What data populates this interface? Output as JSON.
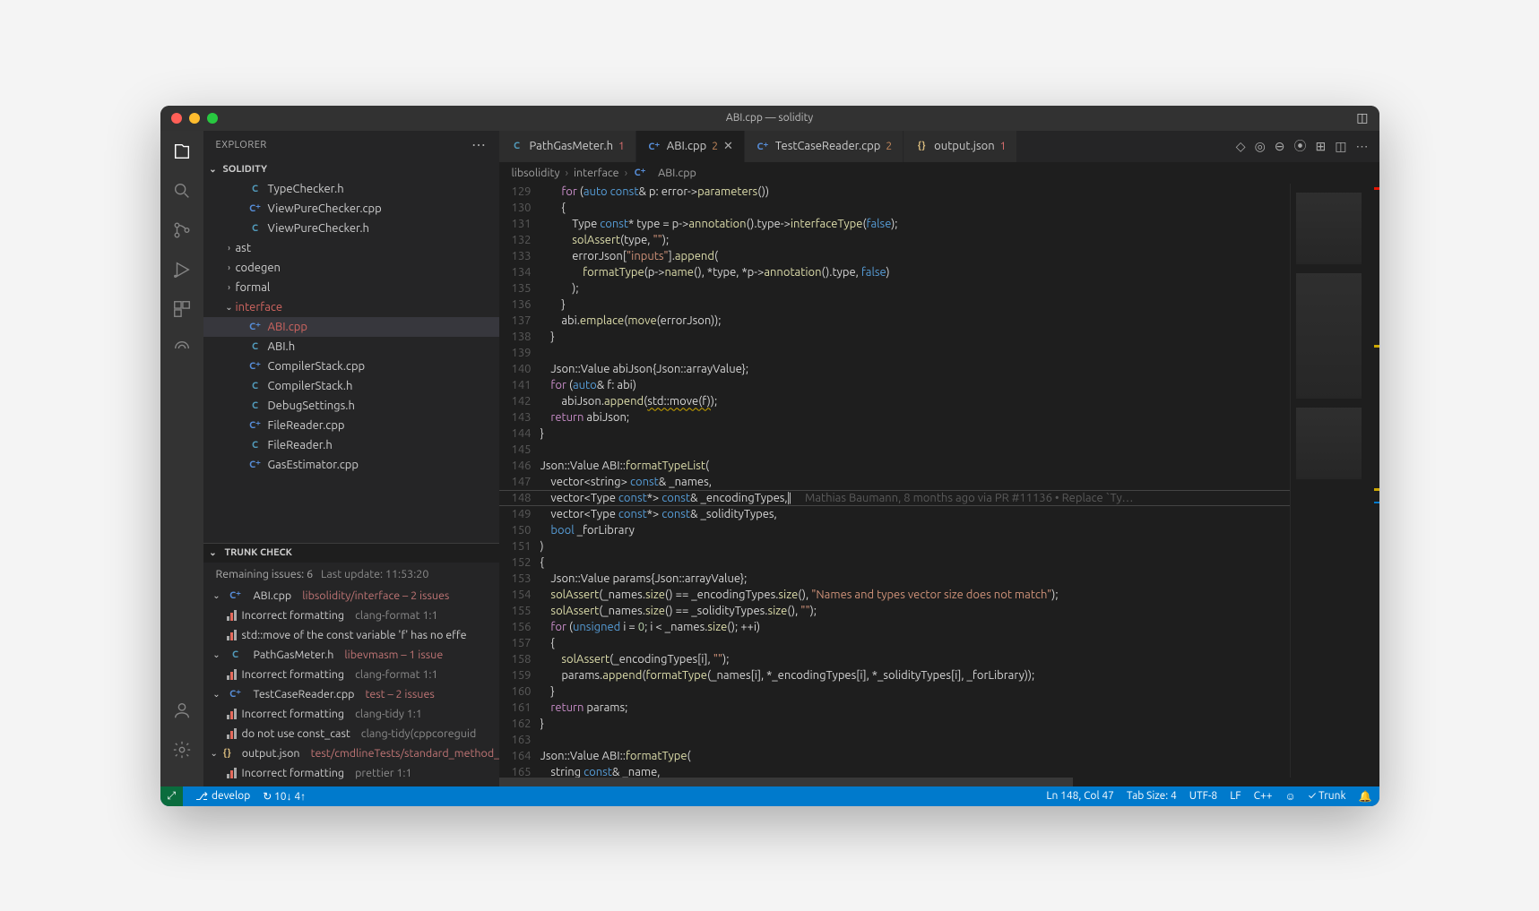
{
  "window": {
    "title": "ABI.cpp — solidity"
  },
  "sidebar": {
    "header": "EXPLORER",
    "root": "SOLIDITY",
    "tree": [
      {
        "icon": "C",
        "label": "TypeChecker.h",
        "cls": "c",
        "indent": 2
      },
      {
        "icon": "C⁺",
        "label": "ViewPureChecker.cpp",
        "cls": "cpp",
        "indent": 2
      },
      {
        "icon": "C",
        "label": "ViewPureChecker.h",
        "cls": "c",
        "indent": 2
      },
      {
        "chev": "›",
        "label": "ast",
        "indent": 1
      },
      {
        "chev": "›",
        "label": "codegen",
        "indent": 1
      },
      {
        "chev": "›",
        "label": "formal",
        "indent": 1
      },
      {
        "chev": "⌄",
        "label": "interface",
        "indent": 1,
        "modified": true
      },
      {
        "icon": "C⁺",
        "label": "ABI.cpp",
        "cls": "cpp",
        "indent": 2,
        "selected": true,
        "modified": true
      },
      {
        "icon": "C",
        "label": "ABI.h",
        "cls": "c",
        "indent": 2
      },
      {
        "icon": "C⁺",
        "label": "CompilerStack.cpp",
        "cls": "cpp",
        "indent": 2
      },
      {
        "icon": "C",
        "label": "CompilerStack.h",
        "cls": "c",
        "indent": 2
      },
      {
        "icon": "C",
        "label": "DebugSettings.h",
        "cls": "c",
        "indent": 2
      },
      {
        "icon": "C⁺",
        "label": "FileReader.cpp",
        "cls": "cpp",
        "indent": 2
      },
      {
        "icon": "C",
        "label": "FileReader.h",
        "cls": "c",
        "indent": 2
      },
      {
        "icon": "C⁺",
        "label": "GasEstimator.cpp",
        "cls": "cpp",
        "indent": 2
      }
    ]
  },
  "trunk": {
    "title": "TRUNK CHECK",
    "summary": "Remaining issues: 6",
    "timestamp": "Last update: 11:53:20",
    "files": [
      {
        "icon": "C⁺",
        "cls": "cpp",
        "name": "ABI.cpp",
        "path": "libsolidity/interface – 2 issues",
        "issues": [
          {
            "msg": "Incorrect formatting",
            "tool": "clang-format 1:1"
          },
          {
            "msg": "std::move of the const variable 'f' has no effe",
            "tool": ""
          }
        ]
      },
      {
        "icon": "C",
        "cls": "c",
        "name": "PathGasMeter.h",
        "path": "libevmasm – 1 issue",
        "issues": [
          {
            "msg": "Incorrect formatting",
            "tool": "clang-format 1:1"
          }
        ]
      },
      {
        "icon": "C⁺",
        "cls": "cpp",
        "name": "TestCaseReader.cpp",
        "path": "test – 2 issues",
        "issues": [
          {
            "msg": "Incorrect formatting",
            "tool": "clang-tidy 1:1"
          },
          {
            "msg": "do not use const_cast",
            "tool": "clang-tidy(cppcoreguid"
          }
        ]
      },
      {
        "icon": "{}",
        "cls": "json",
        "name": "output.json",
        "path": "test/cmdlineTests/standard_method_",
        "issues": [
          {
            "msg": "Incorrect formatting",
            "tool": "prettier 1:1"
          }
        ]
      }
    ]
  },
  "tabs": [
    {
      "icon": "C",
      "cls": "c",
      "label": "PathGasMeter.h",
      "badge": "1",
      "badgeCls": "red"
    },
    {
      "icon": "C⁺",
      "cls": "cpp",
      "label": "ABI.cpp",
      "badge": "2",
      "active": true,
      "close": true
    },
    {
      "icon": "C⁺",
      "cls": "cpp",
      "label": "TestCaseReader.cpp",
      "badge": "2"
    },
    {
      "icon": "{}",
      "cls": "json",
      "label": "output.json",
      "badge": "1",
      "badgeCls": "red"
    }
  ],
  "breadcrumb": [
    "libsolidity",
    "interface",
    "ABI.cpp"
  ],
  "code": {
    "start": 129,
    "lines": [
      "        <kw>for</kw> (<bl>auto</bl> <bl>const</bl>&amp; p: error-&gt;<fn>parameters</fn>())",
      "        {",
      "            Type <bl>const</bl>* type = p-&gt;<fn>annotation</fn>().type-&gt;<fn>interfaceType</fn>(<bl>false</bl>);",
      "            <fn>solAssert</fn>(type, <st>\"\"</st>);",
      "            errorJson[<st>\"inputs\"</st>].<fn>append</fn>(",
      "                <fn>formatType</fn>(p-&gt;<fn>name</fn>(), *type, *p-&gt;<fn>annotation</fn>().type, <bl>false</bl>)",
      "            );",
      "        }",
      "        abi.<fn>emplace</fn>(<fn>move</fn>(errorJson));",
      "    }",
      "",
      "    Json::Value abiJson{Json::arrayValue};",
      "    <kw>for</kw> (<bl>auto</bl>&amp; f: abi)",
      "        abiJson.<fn>append</fn>(<warn>std::move(f)</warn>);",
      "    <kw>return</kw> abiJson;",
      "}",
      "",
      "Json::Value ABI::<fn>formatTypeList</fn>(",
      "    vector&lt;string&gt; <bl>const</bl>&amp; _names,",
      "    vector&lt;Type <bl>const</bl>*&gt; <bl>const</bl>&amp; _encodingTypes,<cur>|</cur>     <lens>Mathias Baumann, 8 months ago via PR #11136 • Replace `Ty…</lens>",
      "    vector&lt;Type <bl>const</bl>*&gt; <bl>const</bl>&amp; _solidityTypes,",
      "    <bl>bool</bl> _forLibrary",
      ")",
      "{",
      "    Json::Value params{Json::arrayValue};",
      "    <fn>solAssert</fn>(_names.<fn>size</fn>() == _encodingTypes.<fn>size</fn>(), <st>\"Names and types vector size does not match\"</st>);",
      "    <fn>solAssert</fn>(_names.<fn>size</fn>() == _solidityTypes.<fn>size</fn>(), <st>\"\"</st>);",
      "    <kw>for</kw> (<bl>unsigned</bl> i = <nm>0</nm>; i &lt; _names.<fn>size</fn>(); ++i)",
      "    {",
      "        <fn>solAssert</fn>(_encodingTypes[i], <st>\"\"</st>);",
      "        params.<fn>append</fn>(<fn>formatType</fn>(_names[i], *_encodingTypes[i], *_solidityTypes[i], _forLibrary));",
      "    }",
      "    <kw>return</kw> params;",
      "}",
      "",
      "Json::Value ABI::<fn>formatType</fn>(",
      "    string <bl>const</bl>&amp; _name,"
    ]
  },
  "status": {
    "branch": "develop",
    "sync": "↻ 10↓ 4↑",
    "cursor": "Ln 148, Col 47",
    "tabsize": "Tab Size: 4",
    "encoding": "UTF-8",
    "eol": "LF",
    "lang": "C++",
    "trunk": "✓ Trunk"
  }
}
